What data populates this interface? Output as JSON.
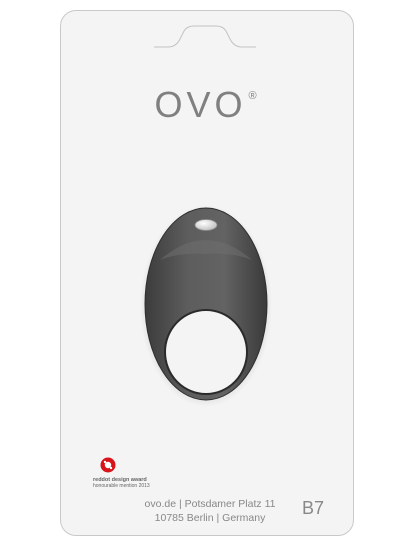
{
  "brand": {
    "name": "OVO",
    "registered_mark": "®"
  },
  "product": {
    "color": "#5a5a5a",
    "button_color": "#e6e6e6"
  },
  "award": {
    "logo_text": "red",
    "title": "reddot design award",
    "subtitle": "honourable mention 2013",
    "logo_color": "#d8141b"
  },
  "address": {
    "line1": "ovo.de | Potsdamer Platz 11",
    "line2": "10785 Berlin | Germany"
  },
  "model": "B7"
}
